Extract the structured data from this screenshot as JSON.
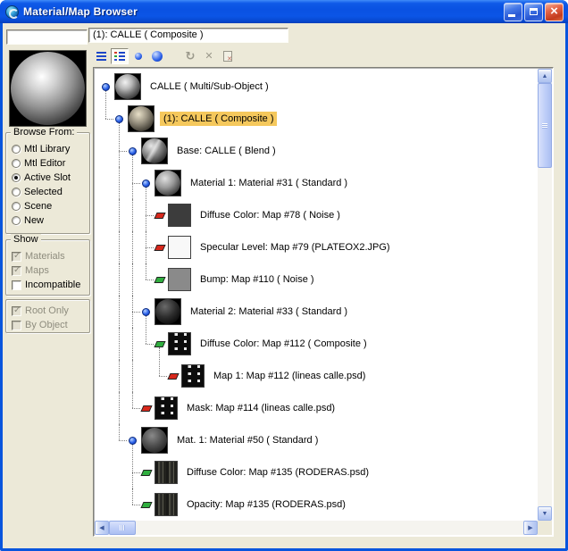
{
  "window": {
    "title": "Material/Map Browser",
    "controls": [
      {
        "name": "minimize"
      },
      {
        "name": "maximize"
      },
      {
        "name": "close"
      }
    ]
  },
  "header": {
    "name_field_value": "",
    "path_text": "(1): CALLE  ( Composite )"
  },
  "sidebar": {
    "browse_from": {
      "label": "Browse From:",
      "options": [
        {
          "label": "Mtl Library",
          "selected": false,
          "disabled": false
        },
        {
          "label": "Mtl Editor",
          "selected": false,
          "disabled": false
        },
        {
          "label": "Active Slot",
          "selected": true,
          "disabled": false
        },
        {
          "label": "Selected",
          "selected": false,
          "disabled": false
        },
        {
          "label": "Scene",
          "selected": false,
          "disabled": false
        },
        {
          "label": "New",
          "selected": false,
          "disabled": false
        }
      ]
    },
    "show": {
      "label": "Show",
      "checkboxes": [
        {
          "label": "Materials",
          "checked": true,
          "disabled": true
        },
        {
          "label": "Maps",
          "checked": true,
          "disabled": true
        },
        {
          "label": "Incompatible",
          "checked": false,
          "disabled": false
        }
      ],
      "checkboxes2": [
        {
          "label": "Root Only",
          "checked": true,
          "disabled": true
        },
        {
          "label": "By Object",
          "checked": false,
          "disabled": true
        }
      ]
    }
  },
  "toolbar": {
    "buttons": [
      {
        "icon": "view-list-icon",
        "active": false,
        "disabled": false,
        "gap": false
      },
      {
        "icon": "view-list-plus-icons-icon",
        "active": true,
        "disabled": false,
        "gap": false
      },
      {
        "icon": "view-small-icons-icon",
        "active": false,
        "disabled": false,
        "gap": false
      },
      {
        "icon": "view-large-icons-icon",
        "active": false,
        "disabled": false,
        "gap": false
      },
      {
        "icon": "update-scene-materials-icon",
        "active": false,
        "disabled": true,
        "gap": true
      },
      {
        "icon": "delete-from-library-icon",
        "active": false,
        "disabled": true,
        "gap": false
      },
      {
        "icon": "clear-material-library-icon",
        "active": false,
        "disabled": true,
        "gap": false
      }
    ]
  },
  "tree": {
    "items": [
      {
        "label": "CALLE  ( Multi/Sub-Object )",
        "level": 0,
        "type": "material",
        "marker": "material-dot",
        "thumb": "sphere-multi-sub",
        "selected": false
      },
      {
        "label": "(1): CALLE  ( Composite )",
        "level": 1,
        "type": "material",
        "marker": "material-dot",
        "thumb": "sphere-calle-composite",
        "selected": true
      },
      {
        "label": "Base: CALLE  ( Blend )",
        "level": 2,
        "type": "material",
        "marker": "material-dot",
        "thumb": "sphere-calle-blend",
        "selected": false
      },
      {
        "label": "Material 1: Material #31  ( Standard )",
        "level": 3,
        "type": "material",
        "marker": "material-dot",
        "thumb": "sphere-material-31",
        "selected": false
      },
      {
        "label": "Diffuse Color: Map #78  ( Noise )",
        "level": 4,
        "type": "map",
        "marker": "map-red",
        "thumb": "swatch-noise-dark",
        "selected": false
      },
      {
        "label": "Specular Level: Map #79 (PLATEOX2.JPG)",
        "level": 4,
        "type": "map",
        "marker": "map-red",
        "thumb": "swatch-white",
        "selected": false
      },
      {
        "label": "Bump: Map #110  ( Noise )",
        "level": 4,
        "type": "map",
        "marker": "map-green",
        "thumb": "swatch-noise-gray",
        "selected": false
      },
      {
        "label": "Material 2: Material #33  ( Standard )",
        "level": 3,
        "type": "material",
        "marker": "material-dot",
        "thumb": "sphere-material-33",
        "selected": false
      },
      {
        "label": "Diffuse Color: Map #112  ( Composite )",
        "level": 4,
        "type": "map",
        "marker": "map-green",
        "thumb": "swatch-dashed-lines",
        "selected": false
      },
      {
        "label": "Map 1: Map #112 (lineas calle.psd)",
        "level": 5,
        "type": "map",
        "marker": "map-red",
        "thumb": "swatch-dashed-lines",
        "selected": false
      },
      {
        "label": "Mask: Map #114 (lineas calle.psd)",
        "level": 3,
        "type": "map",
        "marker": "map-red",
        "thumb": "swatch-dashed-lines",
        "selected": false
      },
      {
        "label": "Mat. 1: Material #50  ( Standard )",
        "level": 2,
        "type": "material",
        "marker": "material-dot",
        "thumb": "sphere-material-50",
        "selected": false
      },
      {
        "label": "Diffuse Color: Map #135 (RODERAS.psd)",
        "level": 3,
        "type": "map",
        "marker": "map-green",
        "thumb": "swatch-ruts",
        "selected": false
      },
      {
        "label": "Opacity: Map #135 (RODERAS.psd)",
        "level": 3,
        "type": "map",
        "marker": "map-green",
        "thumb": "swatch-ruts",
        "selected": false
      }
    ]
  }
}
